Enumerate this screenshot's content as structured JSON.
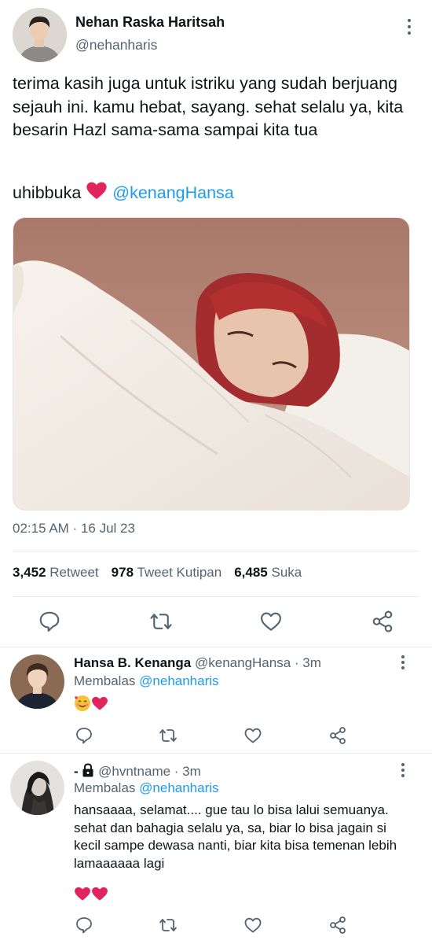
{
  "main_tweet": {
    "display_name": "Nehan Raska Haritsah",
    "handle": "@nehanharis",
    "text": "terima kasih juga untuk istriku yang sudah berjuang sejauh ini. kamu hebat, sayang. sehat selalu ya, kita besarin Hazl sama-sama sampai kita tua",
    "closing_text": "uhibbuka",
    "closing_mention": "@kenangHansa",
    "timestamp": "02:15 AM · 16 Jul 23",
    "stats": {
      "retweets_count": "3,452",
      "retweets_label": "Retweet",
      "quotes_count": "978",
      "quotes_label": "Tweet Kutipan",
      "likes_count": "6,485",
      "likes_label": "Suka"
    }
  },
  "replies": [
    {
      "display_name": "Hansa B. Kenanga",
      "meta": "@kenangHansa · 3m",
      "replying_label": "Membalas",
      "replying_to": "@nehanharis",
      "text": ""
    },
    {
      "display_name": "-",
      "meta": "@hvntname · 3m",
      "replying_label": "Membalas",
      "replying_to": "@nehanharis",
      "text": "hansaaaa, selamat.... gue tau lo bisa lalui semuanya. sehat dan bahagia selalu ya, sa, biar lo bisa jagain si kecil sampe dewasa nanti, biar kita bisa temenan lebih lamaaaaaa lagi"
    }
  ],
  "colors": {
    "accent": "#1d9bf0",
    "heart": "#e0245e",
    "secondary_text": "#536471",
    "primary_text": "#0f1419"
  }
}
